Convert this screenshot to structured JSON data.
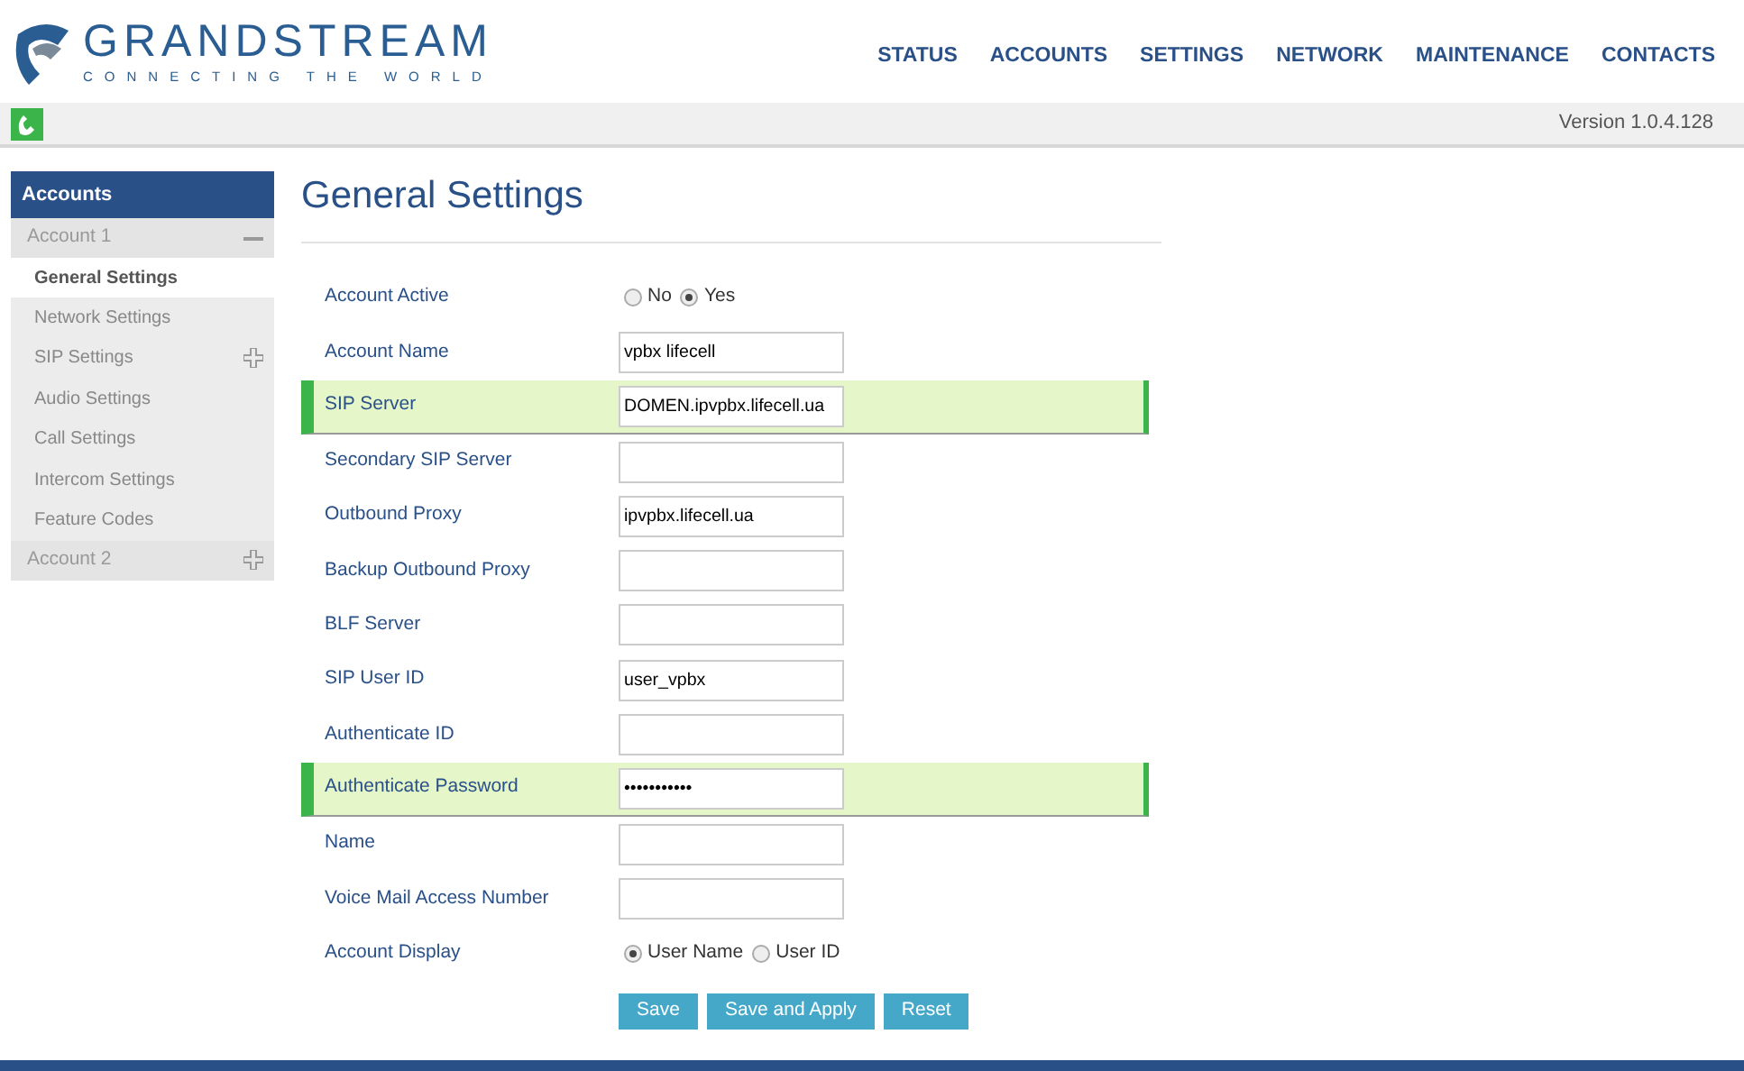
{
  "logo": {
    "name": "GRANDSTREAM",
    "tagline": "CONNECTING THE WORLD"
  },
  "nav": [
    "STATUS",
    "ACCOUNTS",
    "SETTINGS",
    "NETWORK",
    "MAINTENANCE",
    "CONTACTS"
  ],
  "version": "Version 1.0.4.128",
  "sidebar": {
    "title": "Accounts",
    "items": [
      {
        "label": "Account 1",
        "expanded": true,
        "children": [
          {
            "label": "General Settings",
            "selected": true,
            "expandable": false
          },
          {
            "label": "Network Settings",
            "selected": false,
            "expandable": false
          },
          {
            "label": "SIP Settings",
            "selected": false,
            "expandable": true
          },
          {
            "label": "Audio Settings",
            "selected": false,
            "expandable": false
          },
          {
            "label": "Call Settings",
            "selected": false,
            "expandable": false
          },
          {
            "label": "Intercom Settings",
            "selected": false,
            "expandable": false
          },
          {
            "label": "Feature Codes",
            "selected": false,
            "expandable": false
          }
        ]
      },
      {
        "label": "Account 2",
        "expanded": false
      }
    ]
  },
  "page_title": "General Settings",
  "fields": [
    {
      "kind": "radio",
      "label": "Account Active",
      "highlighted": false,
      "options": [
        {
          "label": "No",
          "selected": false
        },
        {
          "label": "Yes",
          "selected": true
        }
      ]
    },
    {
      "kind": "text",
      "label": "Account Name",
      "highlighted": false,
      "value": "vpbx lifecell"
    },
    {
      "kind": "text",
      "label": "SIP Server",
      "highlighted": true,
      "value": "DOMEN.ipvpbx.lifecell.ua"
    },
    {
      "kind": "text",
      "label": "Secondary SIP Server",
      "highlighted": false
    },
    {
      "kind": "text",
      "label": "Outbound Proxy",
      "highlighted": false,
      "value": "ipvpbx.lifecell.ua"
    },
    {
      "kind": "text",
      "label": "Backup Outbound Proxy",
      "highlighted": false
    },
    {
      "kind": "text",
      "label": "BLF Server",
      "highlighted": false
    },
    {
      "kind": "text",
      "label": "SIP User ID",
      "highlighted": false,
      "value": "user_vpbx"
    },
    {
      "kind": "text",
      "label": "Authenticate ID",
      "highlighted": false
    },
    {
      "kind": "text",
      "label": "Authenticate Password",
      "highlighted": true,
      "value": "•••••••••••"
    },
    {
      "kind": "text",
      "label": "Name",
      "highlighted": false
    },
    {
      "kind": "text",
      "label": "Voice Mail Access Number",
      "highlighted": false
    },
    {
      "kind": "radio",
      "label": "Account Display",
      "highlighted": false,
      "options": [
        {
          "label": "User Name",
          "selected": true
        },
        {
          "label": "User ID",
          "selected": false
        }
      ]
    }
  ],
  "buttons": [
    "Save",
    "Save and Apply",
    "Reset"
  ]
}
